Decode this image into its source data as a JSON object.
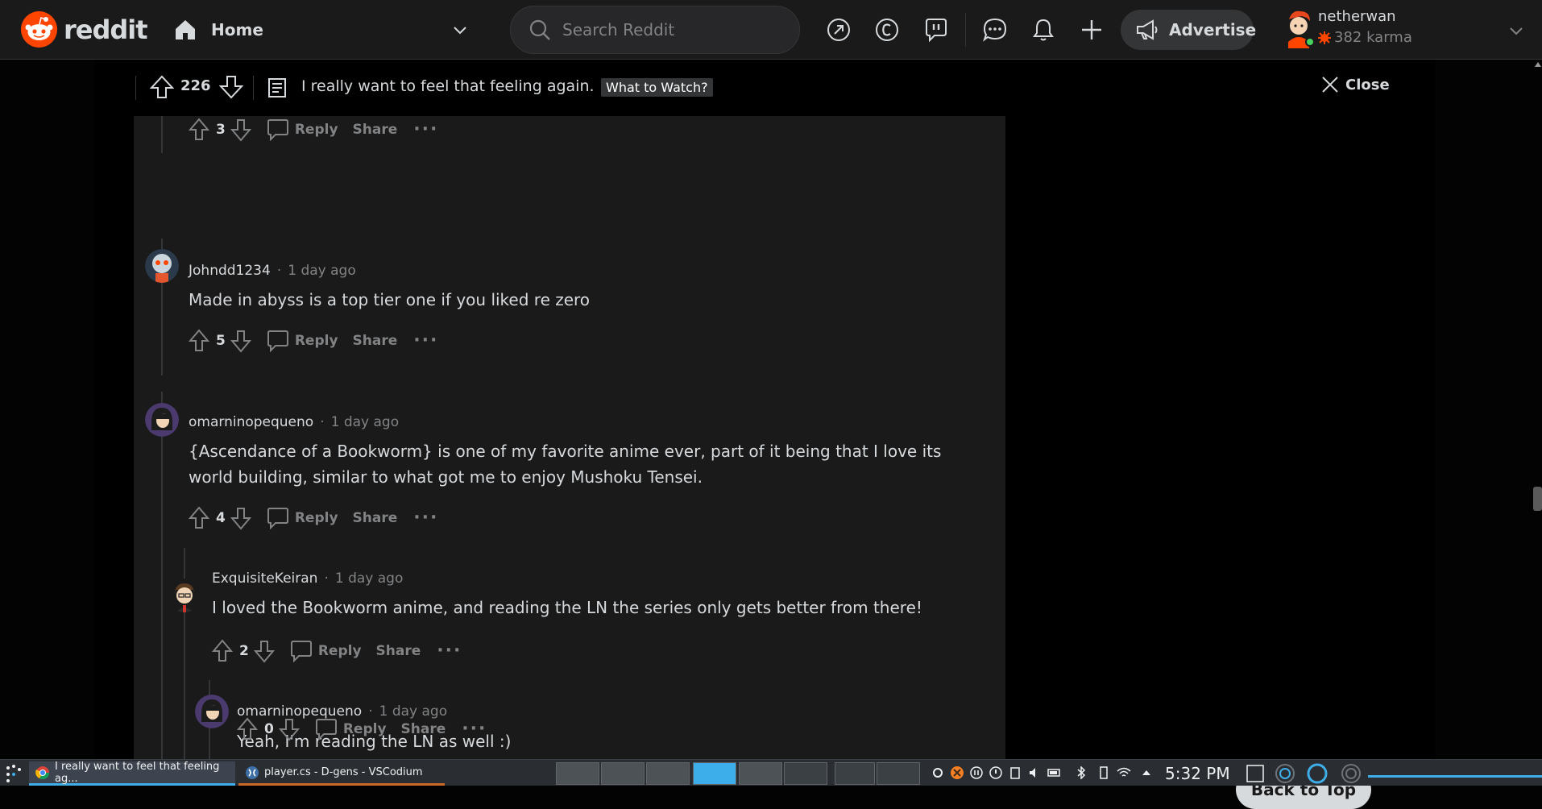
{
  "header": {
    "logo_text": "reddit",
    "home_label": "Home",
    "search_placeholder": "Search Reddit",
    "advertise_label": "Advertise",
    "user": {
      "name": "netherwan",
      "karma": "382 karma"
    },
    "icons": [
      "popular-icon",
      "coins-icon",
      "chat-bubble-icon",
      "messages-icon",
      "notification-bell-icon",
      "create-post-plus-icon",
      "megaphone-icon"
    ]
  },
  "post": {
    "score": "226",
    "title": "I really want to feel that feeling again.",
    "flair": "What to Watch?",
    "close_label": "Close"
  },
  "comments": [
    {
      "author": "",
      "time": "",
      "body": "",
      "votes": "3",
      "reply_label": "Reply",
      "share_label": "Share"
    },
    {
      "author": "Johndd1234",
      "time": "1 day ago",
      "body": "Made in abyss is a top tier one if you liked re zero",
      "votes": "5",
      "reply_label": "Reply",
      "share_label": "Share"
    },
    {
      "author": "omarninopequeno",
      "time": "1 day ago",
      "body_line1": "{Ascendance of a Bookworm} is one of my favorite anime ever, part of it being that I love its",
      "body_line2": "world building, similar to what got me to enjoy Mushoku Tensei.",
      "votes": "4",
      "reply_label": "Reply",
      "share_label": "Share"
    },
    {
      "author": "ExquisiteKeiran",
      "time": "1 day ago",
      "body": "I loved the Bookworm anime, and reading the LN the series only gets better from there!",
      "votes": "2",
      "reply_label": "Reply",
      "share_label": "Share"
    },
    {
      "author": "omarninopequeno",
      "time": "1 day ago",
      "body": "Yeah, I'm reading the LN as well :)",
      "votes": "0",
      "reply_label": "Reply",
      "share_label": "Share"
    }
  ],
  "back_to_top_label": "Back to Top",
  "taskbar": {
    "tasks": [
      {
        "label": "I really want to feel that feeling ag...",
        "icon": "chrome-icon"
      },
      {
        "label": "player.cs - D-gens - VSCodium",
        "icon": "vscodium-icon"
      }
    ],
    "clock": "5:32 PM"
  },
  "colors": {
    "brand": "#ff4500",
    "header_bg": "#1a1a1b",
    "comment_bg": "#1a1a1b",
    "text": "#d7dadc",
    "muted": "#818384",
    "taskbar_bg": "#2a2e32",
    "taskbar_accent": "#3daee9"
  }
}
